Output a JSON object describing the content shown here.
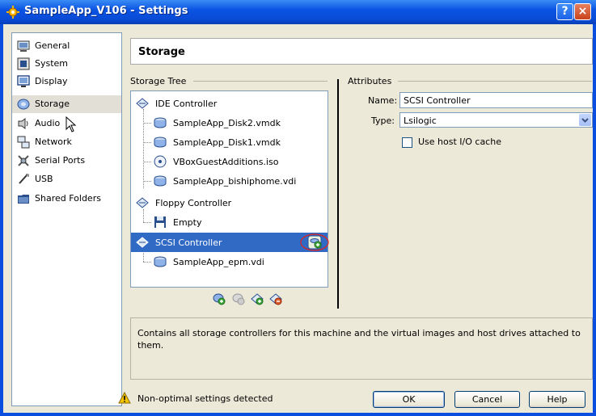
{
  "window": {
    "title": "SampleApp_V106 - Settings",
    "help_glyph": "?",
    "close_glyph": "×"
  },
  "sidebar": {
    "items": [
      {
        "label": "General",
        "icon": "general-icon"
      },
      {
        "label": "System",
        "icon": "system-icon"
      },
      {
        "label": "Display",
        "icon": "display-icon"
      },
      {
        "label": "Storage",
        "icon": "storage-icon",
        "selected": true
      },
      {
        "label": "Audio",
        "icon": "audio-icon"
      },
      {
        "label": "Network",
        "icon": "network-icon"
      },
      {
        "label": "Serial Ports",
        "icon": "serial-ports-icon"
      },
      {
        "label": "USB",
        "icon": "usb-icon"
      },
      {
        "label": "Shared Folders",
        "icon": "shared-folders-icon"
      }
    ]
  },
  "header": {
    "title": "Storage"
  },
  "storage_tree": {
    "label": "Storage Tree",
    "items": [
      {
        "label": "IDE Controller",
        "type": "controller"
      },
      {
        "label": "SampleApp_Disk2.vmdk",
        "type": "hard-disk"
      },
      {
        "label": "SampleApp_Disk1.vmdk",
        "type": "hard-disk"
      },
      {
        "label": "VBoxGuestAdditions.iso",
        "type": "cd"
      },
      {
        "label": "SampleApp_bishiphome.vdi",
        "type": "hard-disk"
      },
      {
        "label": "Floppy Controller",
        "type": "controller"
      },
      {
        "label": "Empty",
        "type": "floppy"
      },
      {
        "label": "SCSI Controller",
        "type": "controller",
        "selected": true
      },
      {
        "label": "SampleApp_epm.vdi",
        "type": "hard-disk"
      }
    ]
  },
  "attributes": {
    "label": "Attributes",
    "name_label": "Name:",
    "name_value": "SCSI Controller",
    "type_label": "Type:",
    "type_value": "Lsilogic",
    "host_io_cache_label": "Use host I/O cache",
    "host_io_cache_checked": false
  },
  "info": {
    "text": "Contains all storage controllers for this machine and the virtual images and host drives attached to them."
  },
  "footer": {
    "warning": "Non-optimal settings detected",
    "ok_label": "OK",
    "cancel_label": "Cancel",
    "help_label": "Help"
  },
  "colors": {
    "selection": "#316ac5",
    "titlebar": "#0a4ee0",
    "annotation": "#e02020"
  }
}
